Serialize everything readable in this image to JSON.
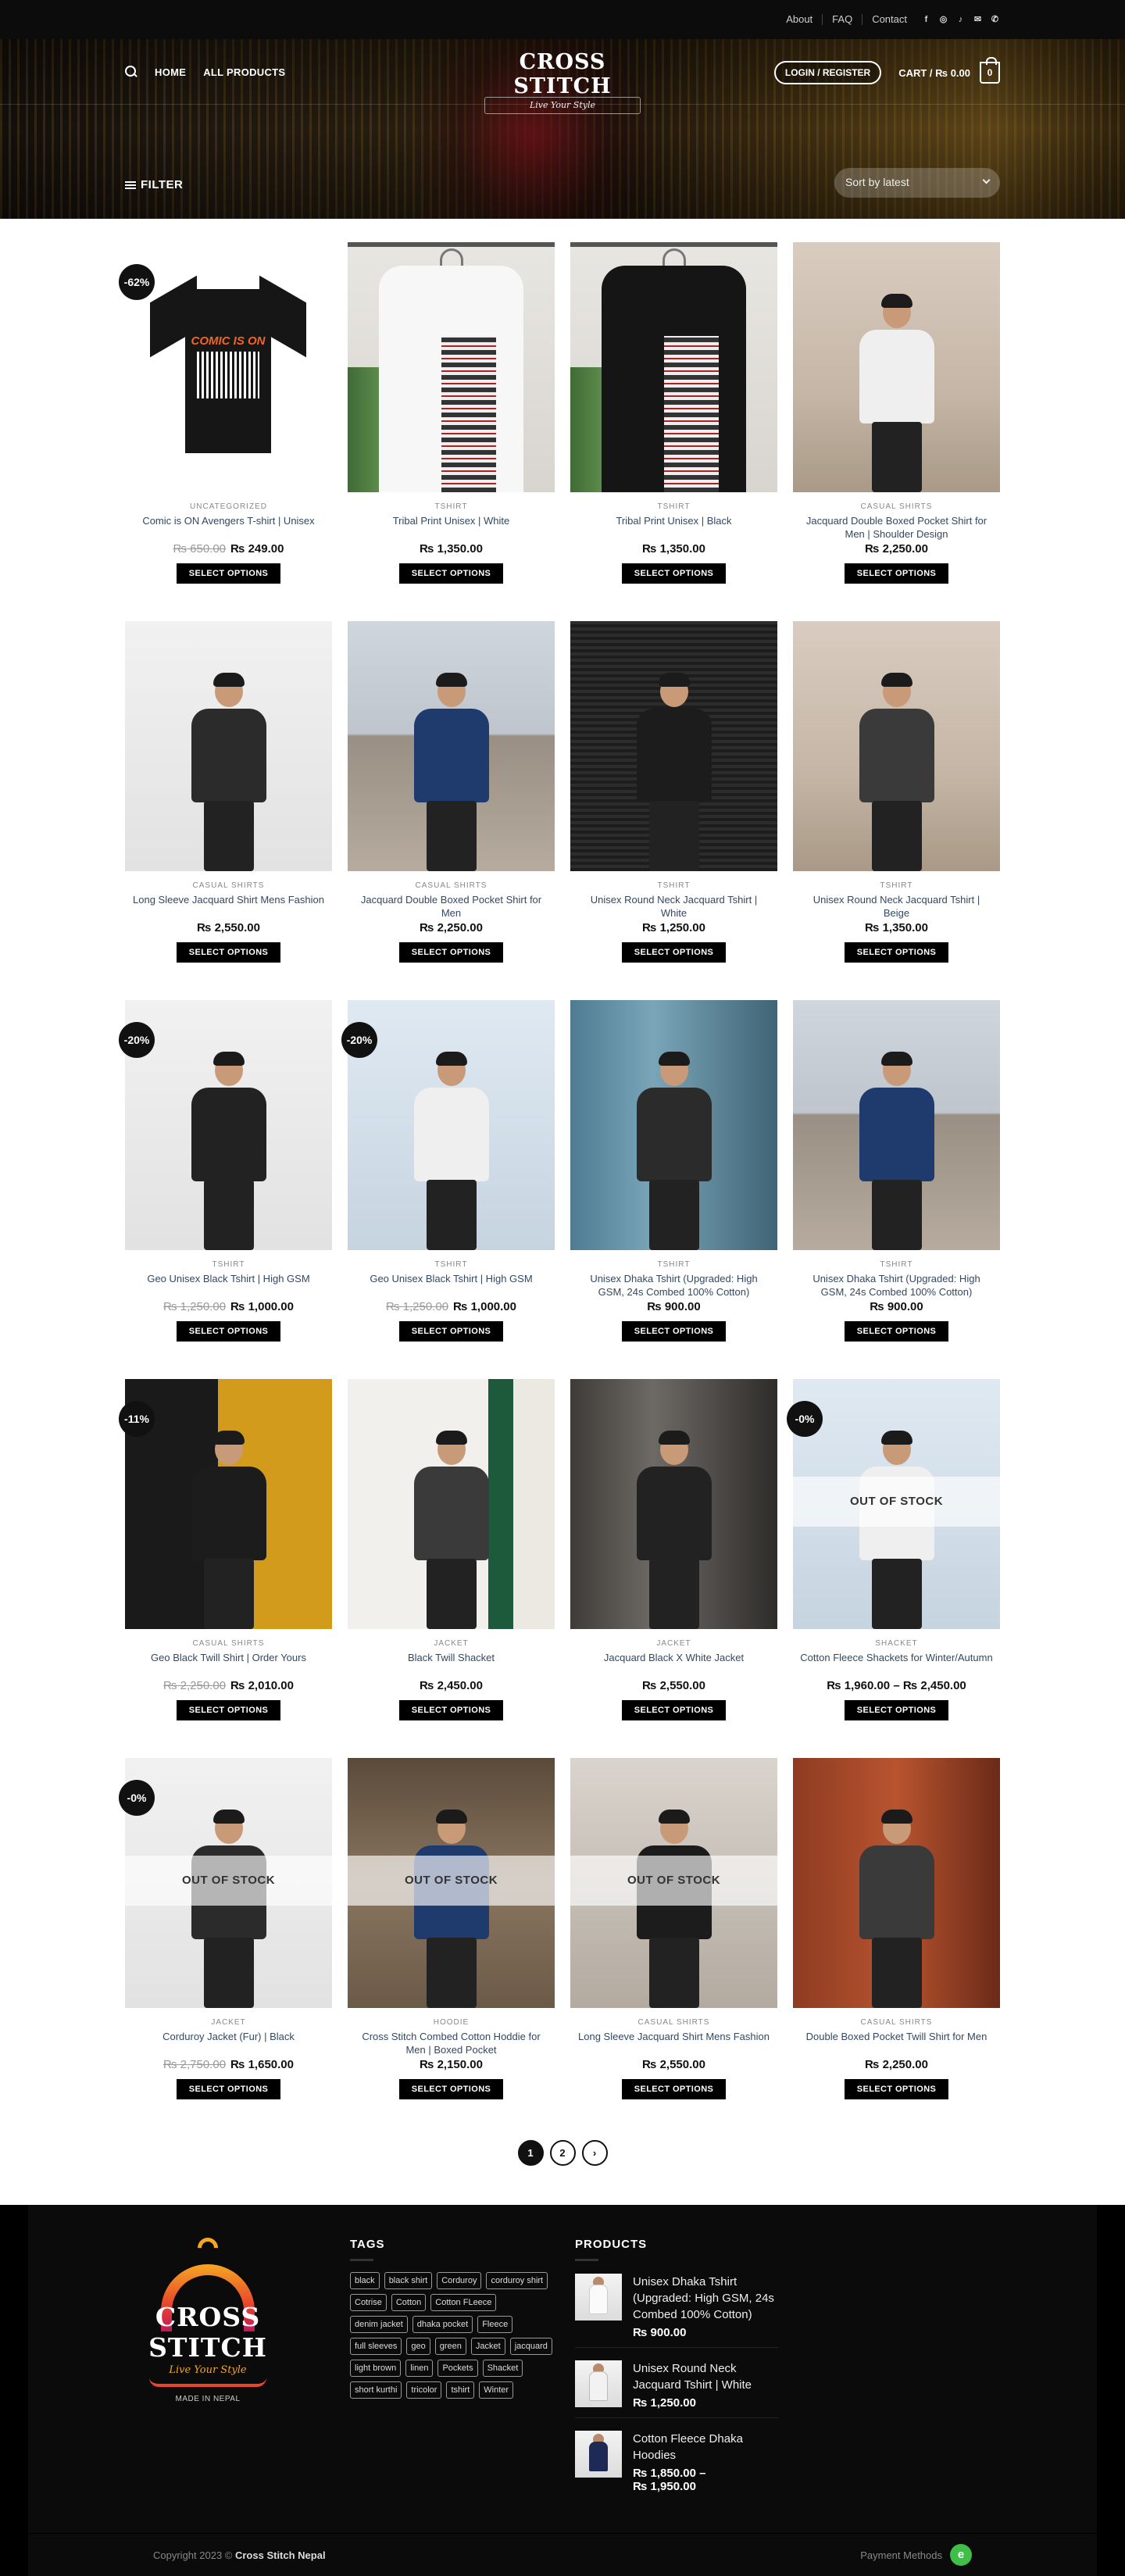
{
  "topbar": {
    "links": [
      "About",
      "FAQ",
      "Contact"
    ],
    "social_icons": [
      "facebook-icon",
      "instagram-icon",
      "tiktok-icon",
      "email-icon",
      "phone-icon"
    ]
  },
  "header": {
    "nav": [
      "HOME",
      "ALL PRODUCTS"
    ],
    "brand": "CROSS STITCH",
    "tagline": "Live Your Style",
    "login": "LOGIN / REGISTER",
    "cart": "CART / ₨ 0.00",
    "cart_count": "0",
    "filter": "FILTER",
    "sort": "Sort by latest"
  },
  "select_label": "SELECT OPTIONS",
  "products": [
    {
      "cat": "UNCATEGORIZED",
      "name": "Comic is ON Avengers T-shirt | Unisex",
      "old": "₨ 650.00",
      "price": "₨ 249.00",
      "badge": "-62%",
      "oos": false,
      "scene": "tee"
    },
    {
      "cat": "TSHIRT",
      "name": "Tribal Print Unisex | White",
      "old": "",
      "price": "₨ 1,350.00",
      "badge": "",
      "oos": false,
      "scene": "hang-white"
    },
    {
      "cat": "TSHIRT",
      "name": "Tribal Print Unisex | Black",
      "old": "",
      "price": "₨ 1,350.00",
      "badge": "",
      "oos": false,
      "scene": "hang-black"
    },
    {
      "cat": "CASUAL SHIRTS",
      "name": "Jacquard Double Boxed Pocket Shirt for Men | Shoulder Design",
      "old": "",
      "price": "₨ 2,250.00",
      "badge": "",
      "oos": false,
      "scene": "build"
    },
    {
      "cat": "CASUAL SHIRTS",
      "name": "Long Sleeve Jacquard Shirt Mens Fashion",
      "old": "",
      "price": "₨ 2,550.00",
      "badge": "",
      "oos": false,
      "scene": "white"
    },
    {
      "cat": "CASUAL SHIRTS",
      "name": "Jacquard Double Boxed Pocket Shirt for Men",
      "old": "",
      "price": "₨ 2,250.00",
      "badge": "",
      "oos": false,
      "scene": "street"
    },
    {
      "cat": "TSHIRT",
      "name": "Unisex Round Neck Jacquard Tshirt | White",
      "old": "",
      "price": "₨ 1,250.00",
      "badge": "",
      "oos": false,
      "scene": "shutter"
    },
    {
      "cat": "TSHIRT",
      "name": "Unisex Round Neck Jacquard Tshirt | Beige",
      "old": "",
      "price": "₨ 1,350.00",
      "badge": "",
      "oos": false,
      "scene": "build"
    },
    {
      "cat": "TSHIRT",
      "name": "Geo Unisex Black Tshirt | High GSM",
      "old": "₨ 1,250.00",
      "price": "₨ 1,000.00",
      "badge": "-20%",
      "oos": false,
      "scene": "white"
    },
    {
      "cat": "TSHIRT",
      "name": "Geo Unisex Black Tshirt | High GSM",
      "old": "₨ 1,250.00",
      "price": "₨ 1,000.00",
      "badge": "-20%",
      "oos": false,
      "scene": "sky"
    },
    {
      "cat": "TSHIRT",
      "name": "Unisex Dhaka Tshirt (Upgraded: High GSM, 24s Combed 100% Cotton)",
      "old": "",
      "price": "₨ 900.00",
      "badge": "",
      "oos": false,
      "scene": "blue"
    },
    {
      "cat": "TSHIRT",
      "name": "Unisex Dhaka Tshirt (Upgraded: High GSM, 24s Combed 100% Cotton)",
      "old": "",
      "price": "₨ 900.00",
      "badge": "",
      "oos": false,
      "scene": "street"
    },
    {
      "cat": "CASUAL SHIRTS",
      "name": "Geo Black Twill Shirt | Order Yours",
      "old": "₨ 2,250.00",
      "price": "₨ 2,010.00",
      "badge": "-11%",
      "oos": false,
      "scene": "yellow"
    },
    {
      "cat": "JACKET",
      "name": "Black Twill Shacket",
      "old": "",
      "price": "₨ 2,450.00",
      "badge": "",
      "oos": false,
      "scene": "wall"
    },
    {
      "cat": "JACKET",
      "name": "Jacquard Black X White Jacket",
      "old": "",
      "price": "₨ 2,550.00",
      "badge": "",
      "oos": false,
      "scene": "shop"
    },
    {
      "cat": "SHACKET",
      "name": "Cotton Fleece Shackets for Winter/Autumn",
      "old": "",
      "price": "₨ 1,960.00 – ₨ 2,450.00",
      "badge": "-0%",
      "oos": true,
      "scene": "sky"
    },
    {
      "cat": "JACKET",
      "name": "Corduroy Jacket (Fur) | Black",
      "old": "₨ 2,750.00",
      "price": "₨ 1,650.00",
      "badge": "-0%",
      "oos": true,
      "scene": "white"
    },
    {
      "cat": "HOODIE",
      "name": "Cross Stitch Combed Cotton Hoddie for Men | Boxed Pocket",
      "old": "",
      "price": "₨ 2,150.00",
      "badge": "",
      "oos": true,
      "scene": "temple"
    },
    {
      "cat": "CASUAL SHIRTS",
      "name": "Long Sleeve Jacquard Shirt Mens Fashion",
      "old": "",
      "price": "₨ 2,550.00",
      "badge": "",
      "oos": true,
      "scene": "gray"
    },
    {
      "cat": "CASUAL SHIRTS",
      "name": "Double Boxed Pocket Twill Shirt for Men",
      "old": "",
      "price": "₨ 2,250.00",
      "badge": "",
      "oos": false,
      "scene": "red"
    }
  ],
  "oos_label": "OUT OF STOCK",
  "pagination": [
    "1",
    "2"
  ],
  "footer": {
    "brand": "CROSS STITCH",
    "tagline": "Live Your Style",
    "made": "MADE IN NEPAL",
    "tags_title": "TAGS",
    "tags": [
      "black",
      "black shirt",
      "Corduroy",
      "corduroy shirt",
      "Cotrise",
      "Cotton",
      "Cotton FLeece",
      "denim jacket",
      "dhaka pocket",
      "Fleece",
      "full sleeves",
      "geo",
      "green",
      "Jacket",
      "jacquard",
      "light brown",
      "linen",
      "Pockets",
      "Shacket",
      "short kurthi",
      "tricolor",
      "tshirt",
      "Winter"
    ],
    "products_title": "PRODUCTS",
    "products": [
      {
        "name": "Unisex Dhaka Tshirt (Upgraded: High GSM, 24s Combed 100% Cotton)",
        "price": "₨ 900.00"
      },
      {
        "name": "Unisex Round Neck Jacquard Tshirt | White",
        "price": "₨ 1,250.00"
      },
      {
        "name": "Cotton Fleece Dhaka Hoodies",
        "price": "₨ 1,850.00 –",
        "price2": "₨ 1,950.00"
      }
    ],
    "copyright_prefix": "Copyright 2023 © ",
    "copyright_brand": "Cross Stitch Nepal",
    "payment": "Payment Methods",
    "payment_icon": "esewa-icon"
  },
  "colors": {
    "accent": "#000000",
    "link": "#334862",
    "badge": "#111111",
    "logo_orange": "#f5a623",
    "logo_red": "#e8452c"
  }
}
